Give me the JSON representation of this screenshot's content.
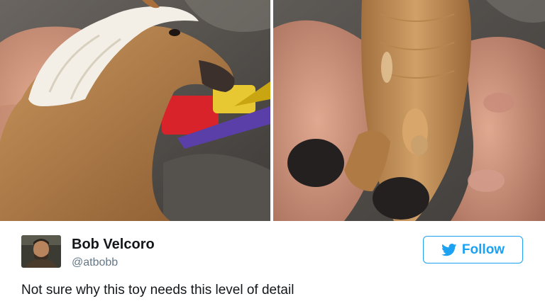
{
  "tweet": {
    "author_name": "Bob Velcoro",
    "author_handle": "@atbobb",
    "follow_label": "Follow",
    "text": "Not sure why this toy needs this level of detail"
  },
  "colors": {
    "twitter_blue": "#1da1f2",
    "name_text": "#14171a",
    "handle_text": "#657786"
  },
  "icons": {
    "follow": "twitter-bird-icon"
  }
}
